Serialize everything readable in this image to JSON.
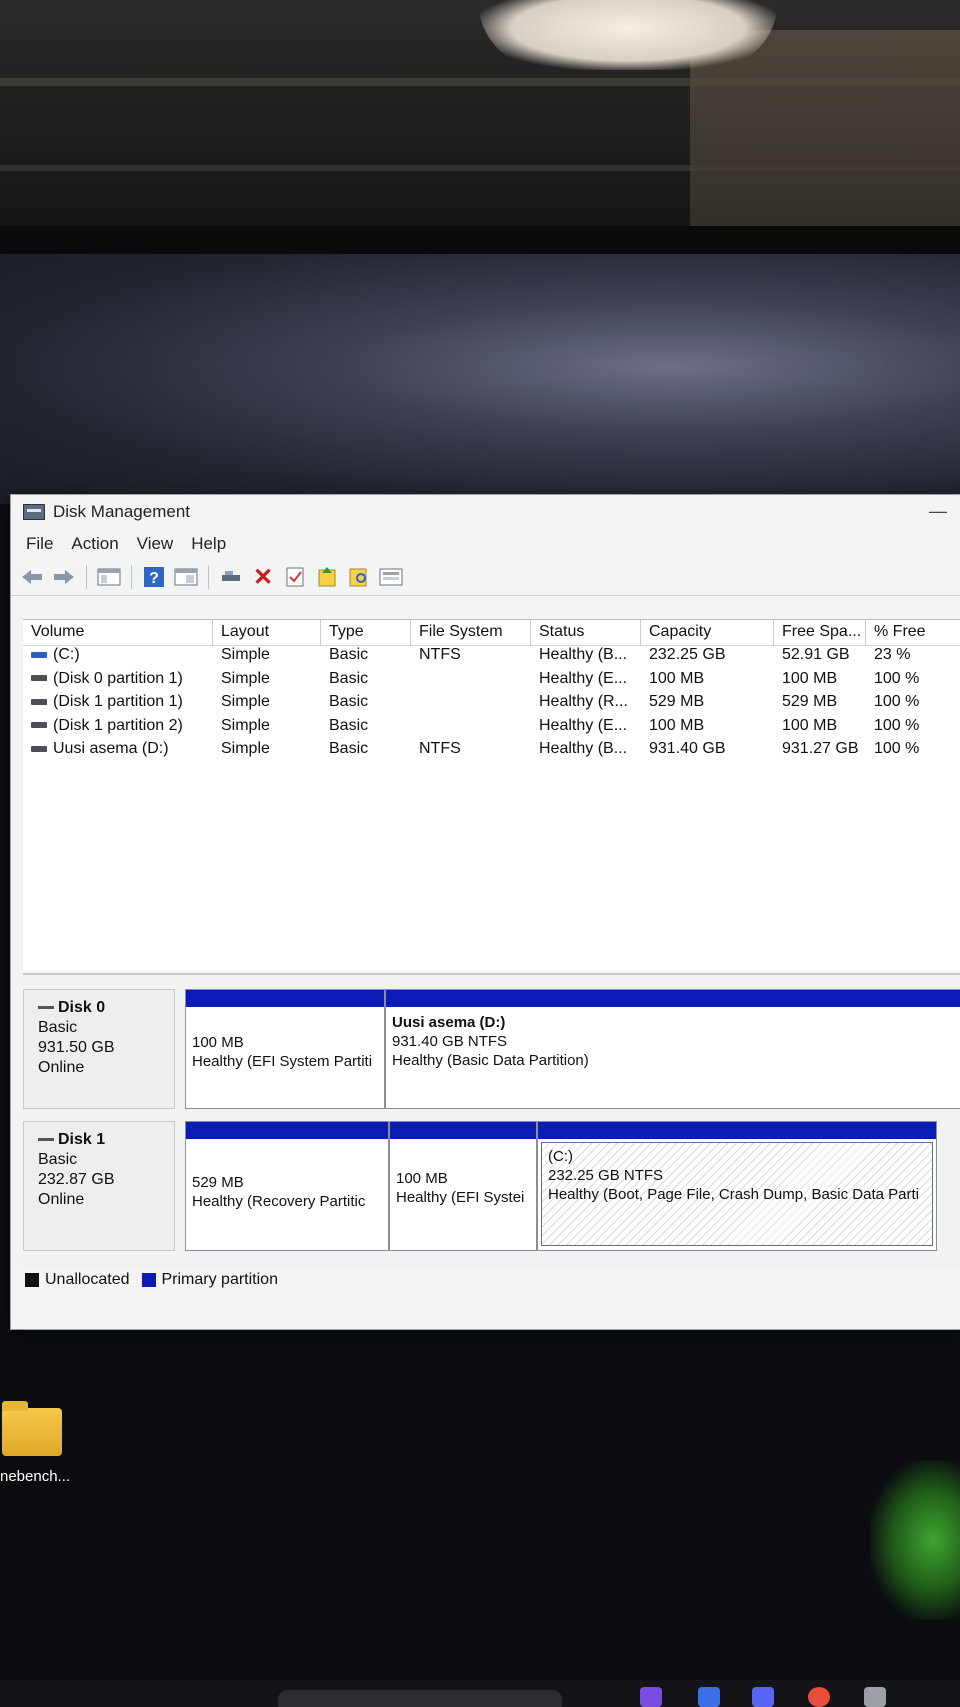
{
  "window": {
    "title": "Disk Management",
    "minimize_glyph": "—"
  },
  "menu": [
    "File",
    "Action",
    "View",
    "Help"
  ],
  "toolbar": {
    "icons": [
      "back-arrow-icon",
      "forward-arrow-icon",
      "console-tree-icon",
      "help-icon",
      "properties-icon",
      "connect-drive-icon",
      "delete-icon",
      "check-icon",
      "rescan-icon",
      "search-icon",
      "view-icon"
    ],
    "delete_glyph": "✕",
    "help_glyph": "?"
  },
  "volumes": {
    "columns": [
      "Volume",
      "Layout",
      "Type",
      "File System",
      "Status",
      "Capacity",
      "Free Spa...",
      "% Free"
    ],
    "rows": [
      [
        "(C:)",
        "Simple",
        "Basic",
        "NTFS",
        "Healthy (B...",
        "232.25 GB",
        "52.91 GB",
        "23 %"
      ],
      [
        "(Disk 0 partition 1)",
        "Simple",
        "Basic",
        "",
        "Healthy (E...",
        "100 MB",
        "100 MB",
        "100 %"
      ],
      [
        "(Disk 1 partition 1)",
        "Simple",
        "Basic",
        "",
        "Healthy (R...",
        "529 MB",
        "529 MB",
        "100 %"
      ],
      [
        "(Disk 1 partition 2)",
        "Simple",
        "Basic",
        "",
        "Healthy (E...",
        "100 MB",
        "100 MB",
        "100 %"
      ],
      [
        "Uusi asema (D:)",
        "Simple",
        "Basic",
        "NTFS",
        "Healthy (B...",
        "931.40 GB",
        "931.27 GB",
        "100 %"
      ]
    ]
  },
  "disks": [
    {
      "name": "Disk 0",
      "type": "Basic",
      "size": "931.50 GB",
      "state": "Online",
      "partitions": [
        {
          "title": "",
          "size": "100 MB",
          "status": "Healthy (EFI System Partiti"
        },
        {
          "title": "Uusi asema  (D:)",
          "size": "931.40 GB NTFS",
          "status": "Healthy (Basic Data Partition)"
        }
      ]
    },
    {
      "name": "Disk 1",
      "type": "Basic",
      "size": "232.87 GB",
      "state": "Online",
      "partitions": [
        {
          "title": "",
          "size": "529 MB",
          "status": "Healthy (Recovery Partitic"
        },
        {
          "title": "",
          "size": "100 MB",
          "status": "Healthy (EFI Systei"
        },
        {
          "title": "(C:)",
          "size": "232.25 GB NTFS",
          "status": "Healthy (Boot, Page File, Crash Dump, Basic Data Parti"
        }
      ]
    }
  ],
  "legend": [
    {
      "label": "Unallocated",
      "color": "#111111"
    },
    {
      "label": "Primary partition",
      "color": "#0a1cb5"
    }
  ],
  "desktop": {
    "icon_label": "nebench..."
  }
}
